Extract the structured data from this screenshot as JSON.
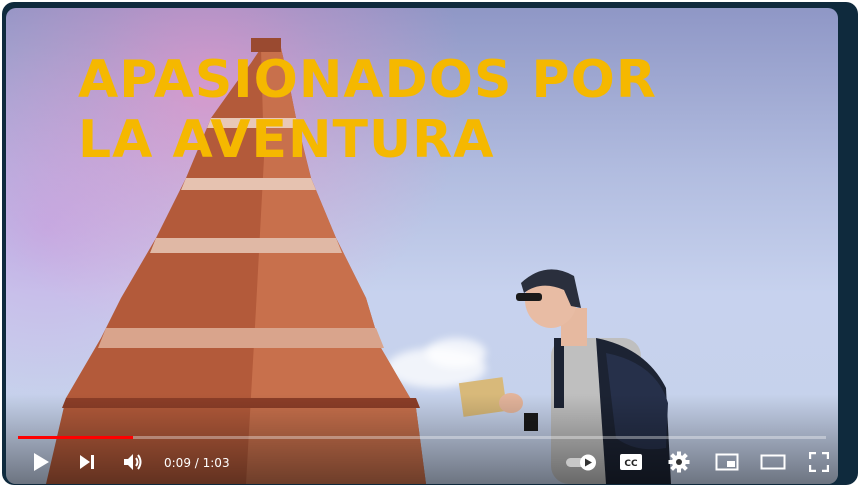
{
  "video": {
    "headline": "APASIONADOS POR\nLA AVENTURA",
    "accent_color": "#f5b800"
  },
  "player": {
    "current_time": "0:09",
    "separator": " / ",
    "duration": "1:03",
    "progress_percent": 14.29,
    "progress_color": "#ff0000",
    "autoplay": "on",
    "icons": {
      "play": "play-icon",
      "next": "next-icon",
      "volume": "volume-icon",
      "autoplay": "autoplay-toggle-icon",
      "captions": "captions-icon",
      "settings": "gear-icon",
      "miniplayer": "miniplayer-icon",
      "theater": "theater-icon",
      "fullscreen": "fullscreen-icon"
    }
  }
}
